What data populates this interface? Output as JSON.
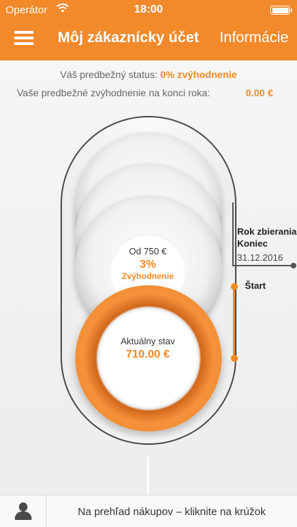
{
  "status_bar": {
    "carrier": "Operátor",
    "time": "18:00"
  },
  "nav": {
    "title": "Môj zákaznícky účet",
    "info": "Informácie"
  },
  "summary": {
    "status_label": "Váš predbežný status:",
    "status_value": "0% zvýhodnenie",
    "year_end_label": "Vaše predbežné zvýhodnenie na konci roka:",
    "year_end_value": "0.00 €"
  },
  "levels": {
    "next_from": "Od 750 €",
    "next_percent": "3%",
    "next_label": "Zvýhodnenie",
    "current_label": "Aktuálny stav",
    "current_value": "710.00 €"
  },
  "timeline": {
    "end_title_line1": "Rok zbierania",
    "end_title_line2": "Koniec",
    "end_date": "31.12.2016",
    "start": "Štart"
  },
  "bottom": {
    "hint": "Na prehľad nákupov – kliknite na krúžok"
  },
  "colors": {
    "brand": "#f2892b",
    "accent": "#f08a24"
  }
}
